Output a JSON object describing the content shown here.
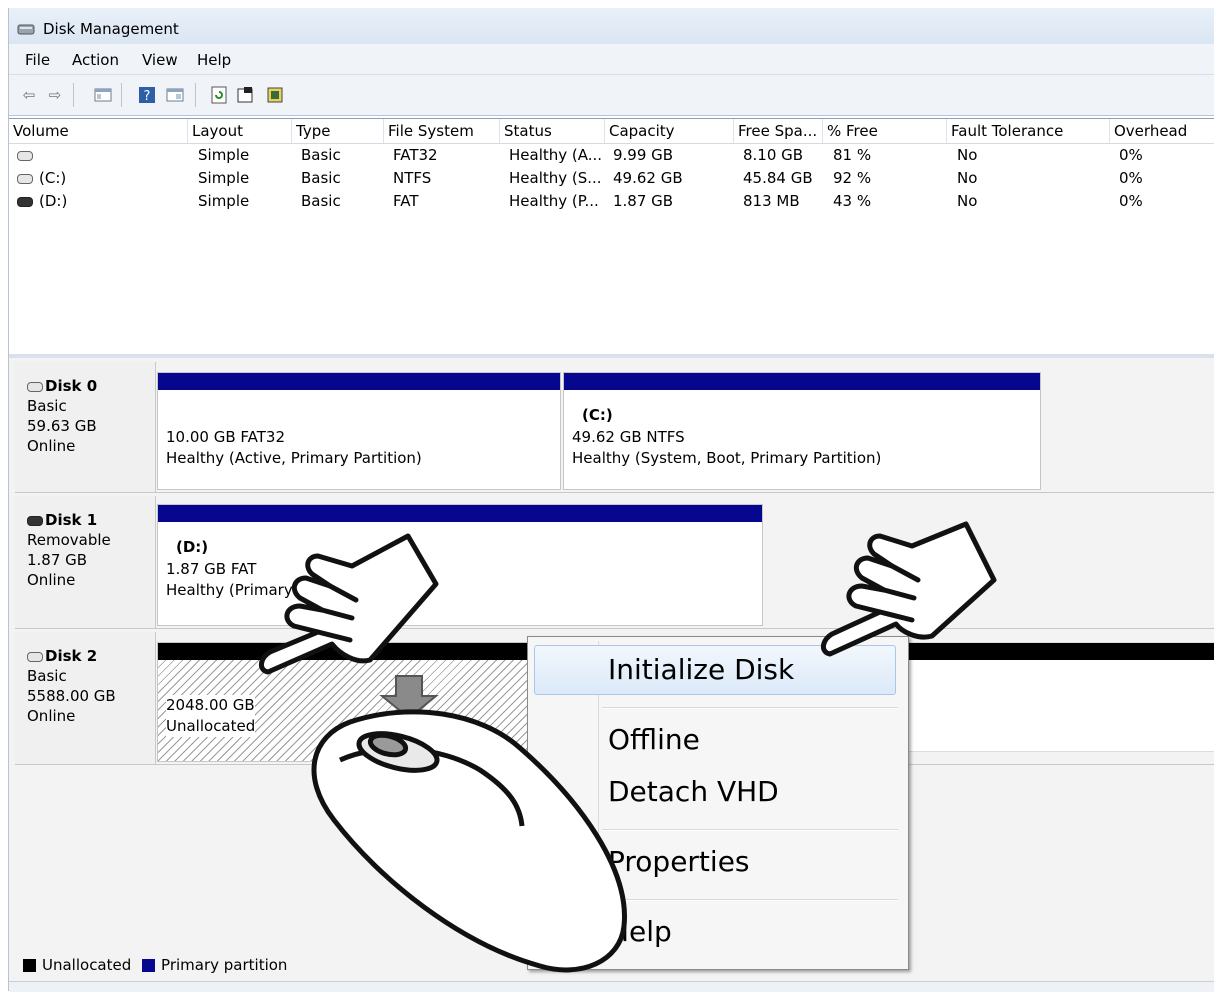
{
  "window": {
    "title": "Disk Management"
  },
  "menu": [
    "File",
    "Action",
    "View",
    "Help"
  ],
  "toolbar_icons": [
    "back-arrow-icon",
    "forward-arrow-icon",
    "console-tree-icon",
    "help-icon",
    "show-pane-icon",
    "refresh-icon",
    "properties-icon",
    "snap-in-icon"
  ],
  "volume_table": {
    "columns": [
      "Volume",
      "Layout",
      "Type",
      "File System",
      "Status",
      "Capacity",
      "Free Spa...",
      "% Free",
      "Fault Tolerance",
      "Overhead"
    ],
    "rows": [
      {
        "volume": "",
        "layout": "Simple",
        "type": "Basic",
        "fs": "FAT32",
        "status": "Healthy (A...",
        "capacity": "9.99 GB",
        "free": "8.10 GB",
        "pct": "81 %",
        "fault": "No",
        "overhead": "0%"
      },
      {
        "volume": "(C:)",
        "layout": "Simple",
        "type": "Basic",
        "fs": "NTFS",
        "status": "Healthy (S...",
        "capacity": "49.62 GB",
        "free": "45.84 GB",
        "pct": "92 %",
        "fault": "No",
        "overhead": "0%"
      },
      {
        "volume": "(D:)",
        "layout": "Simple",
        "type": "Basic",
        "fs": "FAT",
        "status": "Healthy (P...",
        "capacity": "1.87 GB",
        "free": "813 MB",
        "pct": "43 %",
        "fault": "No",
        "overhead": "0%"
      }
    ]
  },
  "disks": [
    {
      "name": "Disk 0",
      "kind": "Basic",
      "size": "59.63 GB",
      "state": "Online",
      "partitions": [
        {
          "label": "",
          "size": "10.00 GB FAT32",
          "status": "Healthy (Active, Primary Partition)"
        },
        {
          "label": "(C:)",
          "size": "49.62 GB NTFS",
          "status": "Healthy (System, Boot, Primary Partition)"
        }
      ]
    },
    {
      "name": "Disk 1",
      "kind": "Removable",
      "size": "1.87 GB",
      "state": "Online",
      "partitions": [
        {
          "label": "(D:)",
          "size": "1.87 GB FAT",
          "status": "Healthy (Primary P"
        }
      ]
    },
    {
      "name": "Disk 2",
      "kind": "Basic",
      "size": "5588.00 GB",
      "state": "Online",
      "partitions": [
        {
          "label": "",
          "size": "2048.00 GB",
          "status": "Unallocated"
        }
      ]
    }
  ],
  "legend": {
    "unallocated": "Unallocated",
    "primary": "Primary partition",
    "colors": {
      "unallocated": "#000000",
      "primary": "#06068f"
    }
  },
  "context_menu": {
    "items": [
      "Initialize Disk",
      "Offline",
      "Detach VHD",
      "Properties",
      "Help"
    ]
  }
}
